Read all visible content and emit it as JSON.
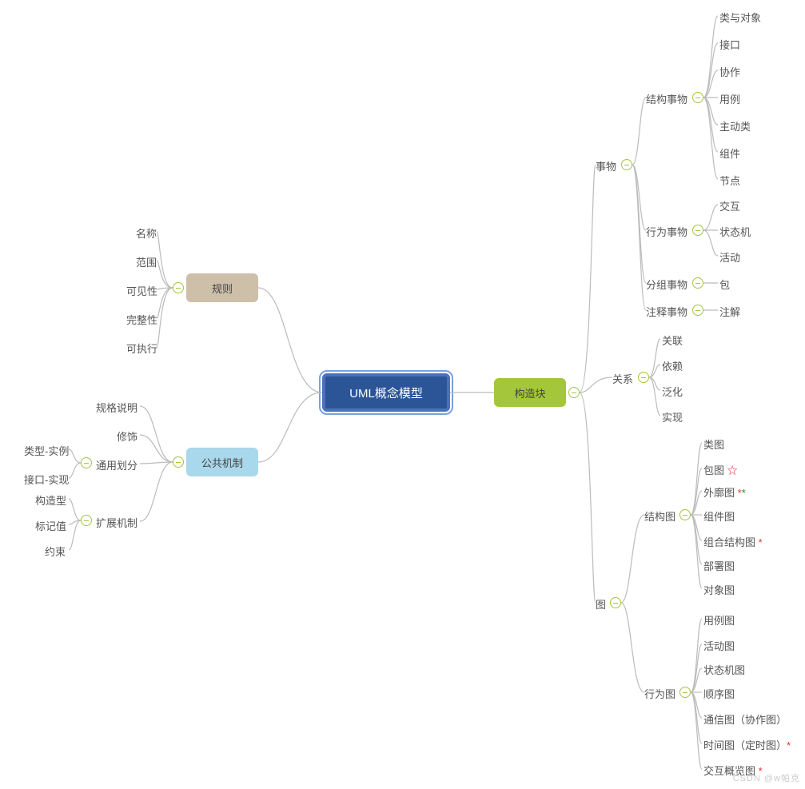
{
  "root": {
    "label": "UML概念模型"
  },
  "right": {
    "box": "构造块",
    "things": {
      "label": "事物",
      "structural": {
        "label": "结构事物",
        "items": [
          "类与对象",
          "接口",
          "协作",
          "用例",
          "主动类",
          "组件",
          "节点"
        ]
      },
      "behavioral": {
        "label": "行为事物",
        "items": [
          "交互",
          "状态机",
          "活动"
        ]
      },
      "grouping": {
        "label": "分组事物",
        "item": "包"
      },
      "annotation": {
        "label": "注释事物",
        "item": "注解"
      }
    },
    "relations": {
      "label": "关系",
      "items": [
        "关联",
        "依赖",
        "泛化",
        "实现"
      ]
    },
    "diagrams": {
      "label": "图",
      "structural": {
        "label": "结构图",
        "items": [
          {
            "t": "类图"
          },
          {
            "t": "包图",
            "mark": "☆"
          },
          {
            "t": "外廓图",
            "mark": "**"
          },
          {
            "t": "组件图"
          },
          {
            "t": "组合结构图",
            "mark": "*"
          },
          {
            "t": "部署图"
          },
          {
            "t": "对象图"
          }
        ]
      },
      "behavioral": {
        "label": "行为图",
        "items": [
          {
            "t": "用例图"
          },
          {
            "t": "活动图"
          },
          {
            "t": "状态机图"
          },
          {
            "t": "顺序图"
          },
          {
            "t": "通信图（协作图）"
          },
          {
            "t": "时间图（定时图）",
            "mark": "*"
          },
          {
            "t": "交互概览图",
            "mark": "*"
          }
        ]
      }
    }
  },
  "left": {
    "rules": {
      "box": "规则",
      "items": [
        "名称",
        "范围",
        "可见性",
        "完整性",
        "可执行"
      ]
    },
    "mechanisms": {
      "box": "公共机制",
      "spec": "规格说明",
      "decoration": "修饰",
      "division": {
        "label": "通用划分",
        "items": [
          "类型-实例",
          "接口-实现"
        ]
      },
      "extension": {
        "label": "扩展机制",
        "items": [
          "构造型",
          "标记值",
          "约束"
        ]
      }
    }
  },
  "watermark": "CSDN @w帕克"
}
